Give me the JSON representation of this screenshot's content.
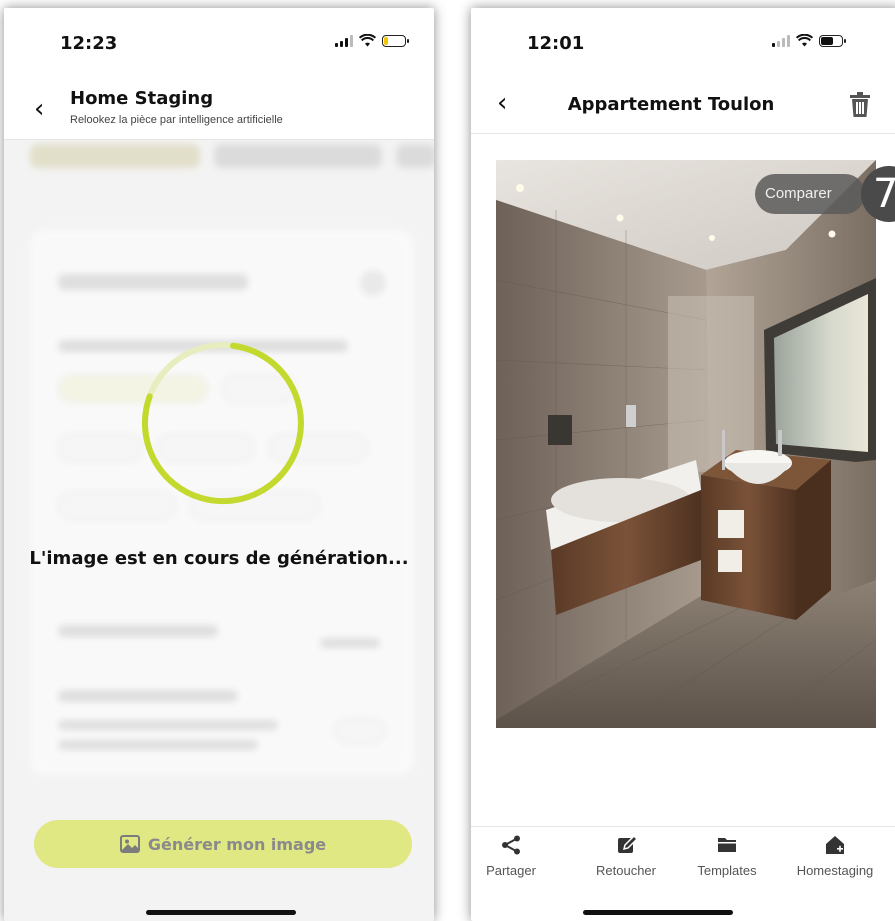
{
  "left_screen": {
    "status": {
      "time": "12:23"
    },
    "header": {
      "back_icon": "chevron-left-icon",
      "title": "Home Staging",
      "subtitle": "Relookez la pièce par intelligence artificielle"
    },
    "loading": {
      "message": "L'image est en cours de génération...",
      "accent_color": "#c4d92e"
    },
    "generate_button": {
      "label": "Générer mon image",
      "icon": "image-icon",
      "color": "#dfe882"
    }
  },
  "right_screen": {
    "status": {
      "time": "12:01"
    },
    "header": {
      "back_icon": "chevron-left-icon",
      "title": "Appartement Toulon",
      "delete_icon": "trash-icon"
    },
    "compare_button": {
      "label": "Comparer"
    },
    "badge": {
      "value": "7"
    },
    "tabbar": [
      {
        "label": "Partager",
        "icon": "share-icon"
      },
      {
        "label": "Retoucher",
        "icon": "edit-icon"
      },
      {
        "label": "Templates",
        "icon": "folder-icon"
      },
      {
        "label": "Homestaging",
        "icon": "home-plus-icon"
      }
    ]
  }
}
